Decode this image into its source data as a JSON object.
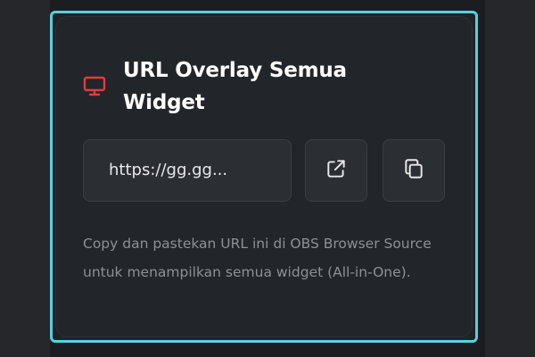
{
  "card": {
    "title": "URL Overlay Semua Widget",
    "title_icon": "monitor-icon",
    "url_value": "https://gg.gg...",
    "open_button_icon": "external-link-icon",
    "copy_button_icon": "copy-icon",
    "description": "Copy dan pastekan URL ini di OBS Browser Source untuk menampilkan semua widget (All-in-One)."
  },
  "colors": {
    "accent_border": "#5ad0dc",
    "icon_red": "#e23b3b",
    "card_bg": "#22252a",
    "title_text": "#ffffff",
    "description_text": "#8d9096"
  }
}
